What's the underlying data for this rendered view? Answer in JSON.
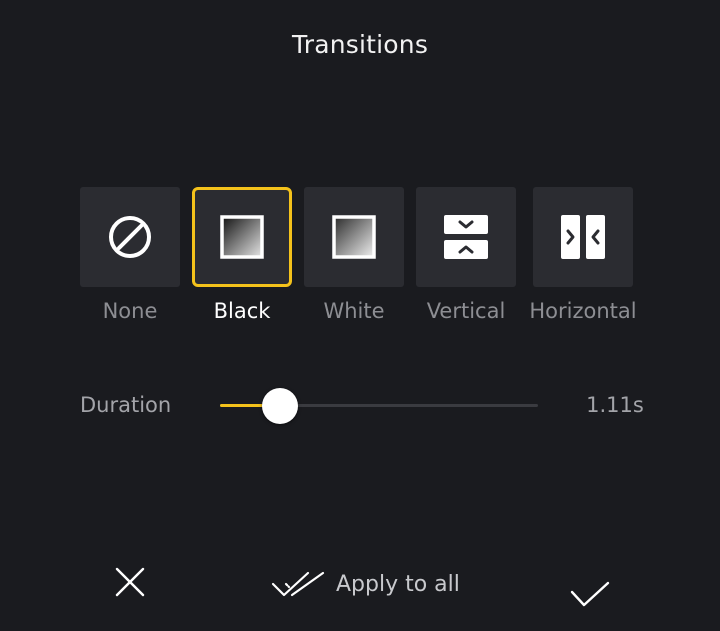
{
  "header": {
    "title": "Transitions"
  },
  "transitions": [
    {
      "id": "none",
      "label": "None",
      "icon": "no-transition-icon"
    },
    {
      "id": "black",
      "label": "Black",
      "icon": "black-fade-icon"
    },
    {
      "id": "white",
      "label": "White",
      "icon": "white-fade-icon"
    },
    {
      "id": "vertical",
      "label": "Vertical",
      "icon": "vertical-split-icon"
    },
    {
      "id": "horizontal",
      "label": "Horizontal",
      "icon": "horizontal-split-icon"
    }
  ],
  "selected_transition": "Black",
  "duration": {
    "label": "Duration",
    "value_text": "1.11s",
    "slider_fraction": 0.19
  },
  "footer": {
    "apply_all_label": "Apply to all",
    "close_icon": "close-icon",
    "confirm_icon": "checkmark-icon",
    "apply_all_icon": "double-check-icon"
  },
  "colors": {
    "background": "#1a1b1f",
    "tile": "#2b2c31",
    "accent": "#f4c21b",
    "text_muted": "#8d8e93",
    "text_active": "#ffffff"
  }
}
